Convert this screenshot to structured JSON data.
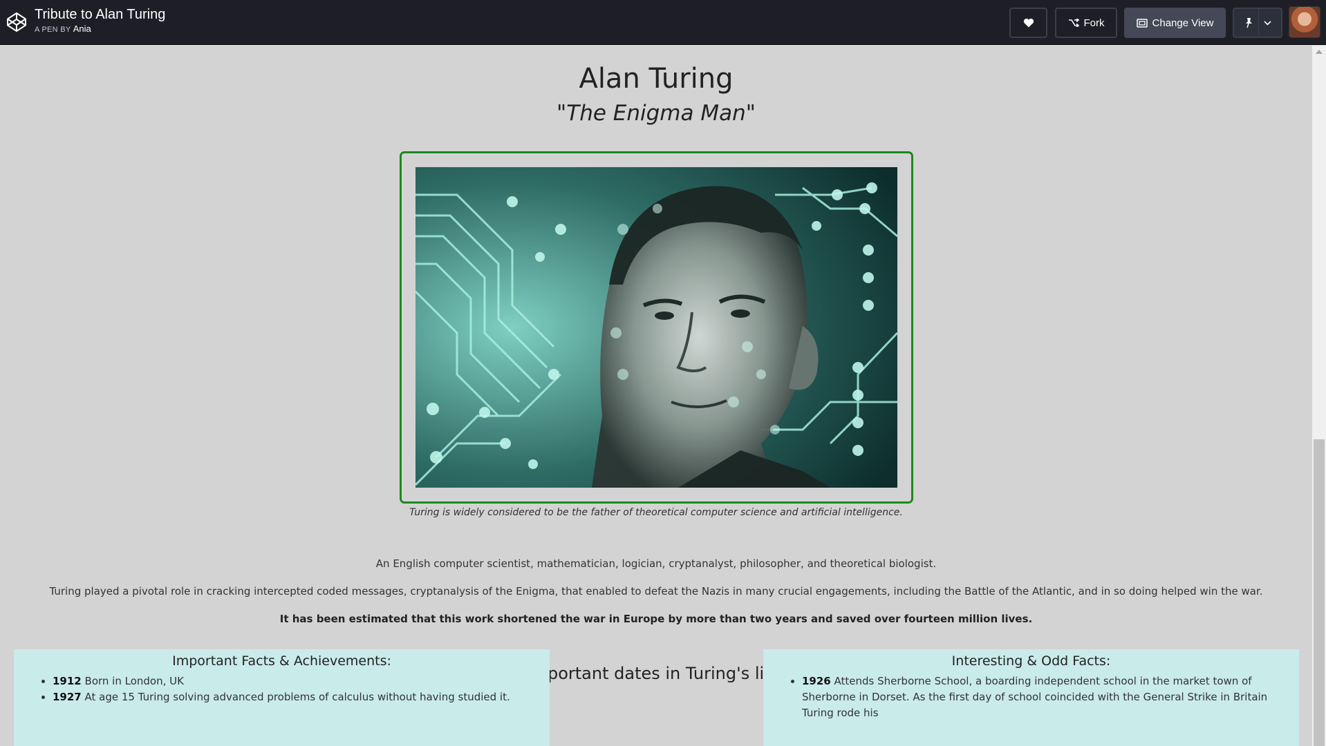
{
  "topbar": {
    "pen_title": "Tribute to Alan Turing",
    "pen_by_prefix": "A PEN BY",
    "author": "Ania",
    "fork_label": "Fork",
    "change_view_label": "Change View"
  },
  "page": {
    "title": "Alan Turing",
    "subtitle": "\"The Enigma Man\"",
    "caption": "Turing is widely considered to be the father of theoretical computer science and artificial intelligence.",
    "para1": "An English computer scientist, mathematician, logician, cryptanalyst, philosopher, and theoretical biologist.",
    "para2": "Turing played a pivotal role in cracking intercepted coded messages, cryptanalysis of the Enigma, that enabled to defeat the Nazis in many crucial engagements, including the Battle of the Atlantic, and in so doing helped win the war.",
    "para3": "It has been estimated that this work shortened the war in Europe by more than two years and saved over fourteen million lives.",
    "dates_heading": "Important dates in Turing's life:",
    "facts_left": {
      "title": "Important Facts & Achievements:",
      "items": [
        {
          "year": "1912",
          "text": "Born in London, UK"
        },
        {
          "year": "1927",
          "text": "At age 15 Turing solving advanced problems of calculus without having studied it."
        }
      ]
    },
    "facts_right": {
      "title": "Interesting & Odd Facts:",
      "items": [
        {
          "year": "1926",
          "text": "Attends Sherborne School, a boarding independent school in the market town of Sherborne in Dorset. As the first day of school coincided with the General Strike in Britain Turing rode his"
        }
      ]
    }
  },
  "icons": {
    "logo": "codepen-logo-icon",
    "heart": "heart-icon",
    "fork": "fork-icon",
    "view": "change-view-icon",
    "pin": "pin-icon",
    "chevron": "chevron-down-icon"
  },
  "colors": {
    "topbar_bg": "#1e1f26",
    "page_bg": "#d3d3d3",
    "frame_border": "#1a8a1a",
    "facts_bg": "#c9ebea"
  }
}
